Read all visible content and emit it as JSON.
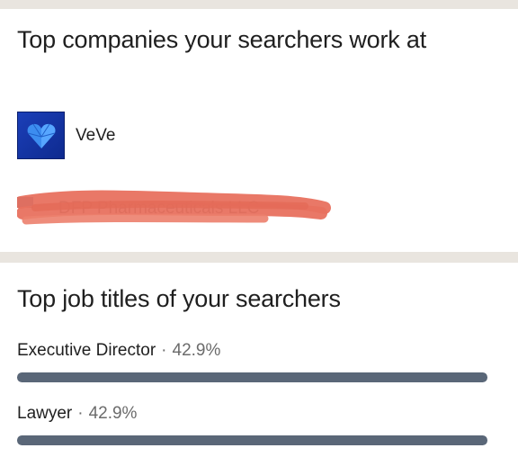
{
  "companies_section": {
    "title": "Top companies your searchers work at",
    "companies": [
      {
        "name": "VeVe",
        "logo_icon": "blue-heart-gem-logo",
        "logo_color": "#1b3fb8"
      },
      {
        "name": "DFP Pharmaceuticals LLC",
        "redacted": true,
        "redaction_color": "#e8715f"
      }
    ]
  },
  "titles_section": {
    "title": "Top job titles of your searchers",
    "items": [
      {
        "title": "Executive Director",
        "separator": "·",
        "percent_label": "42.9%",
        "fraction": 1.0
      },
      {
        "title": "Lawyer",
        "separator": "·",
        "percent_label": "42.9%",
        "fraction": 1.0
      }
    ],
    "bar_color": "#5a6778"
  }
}
